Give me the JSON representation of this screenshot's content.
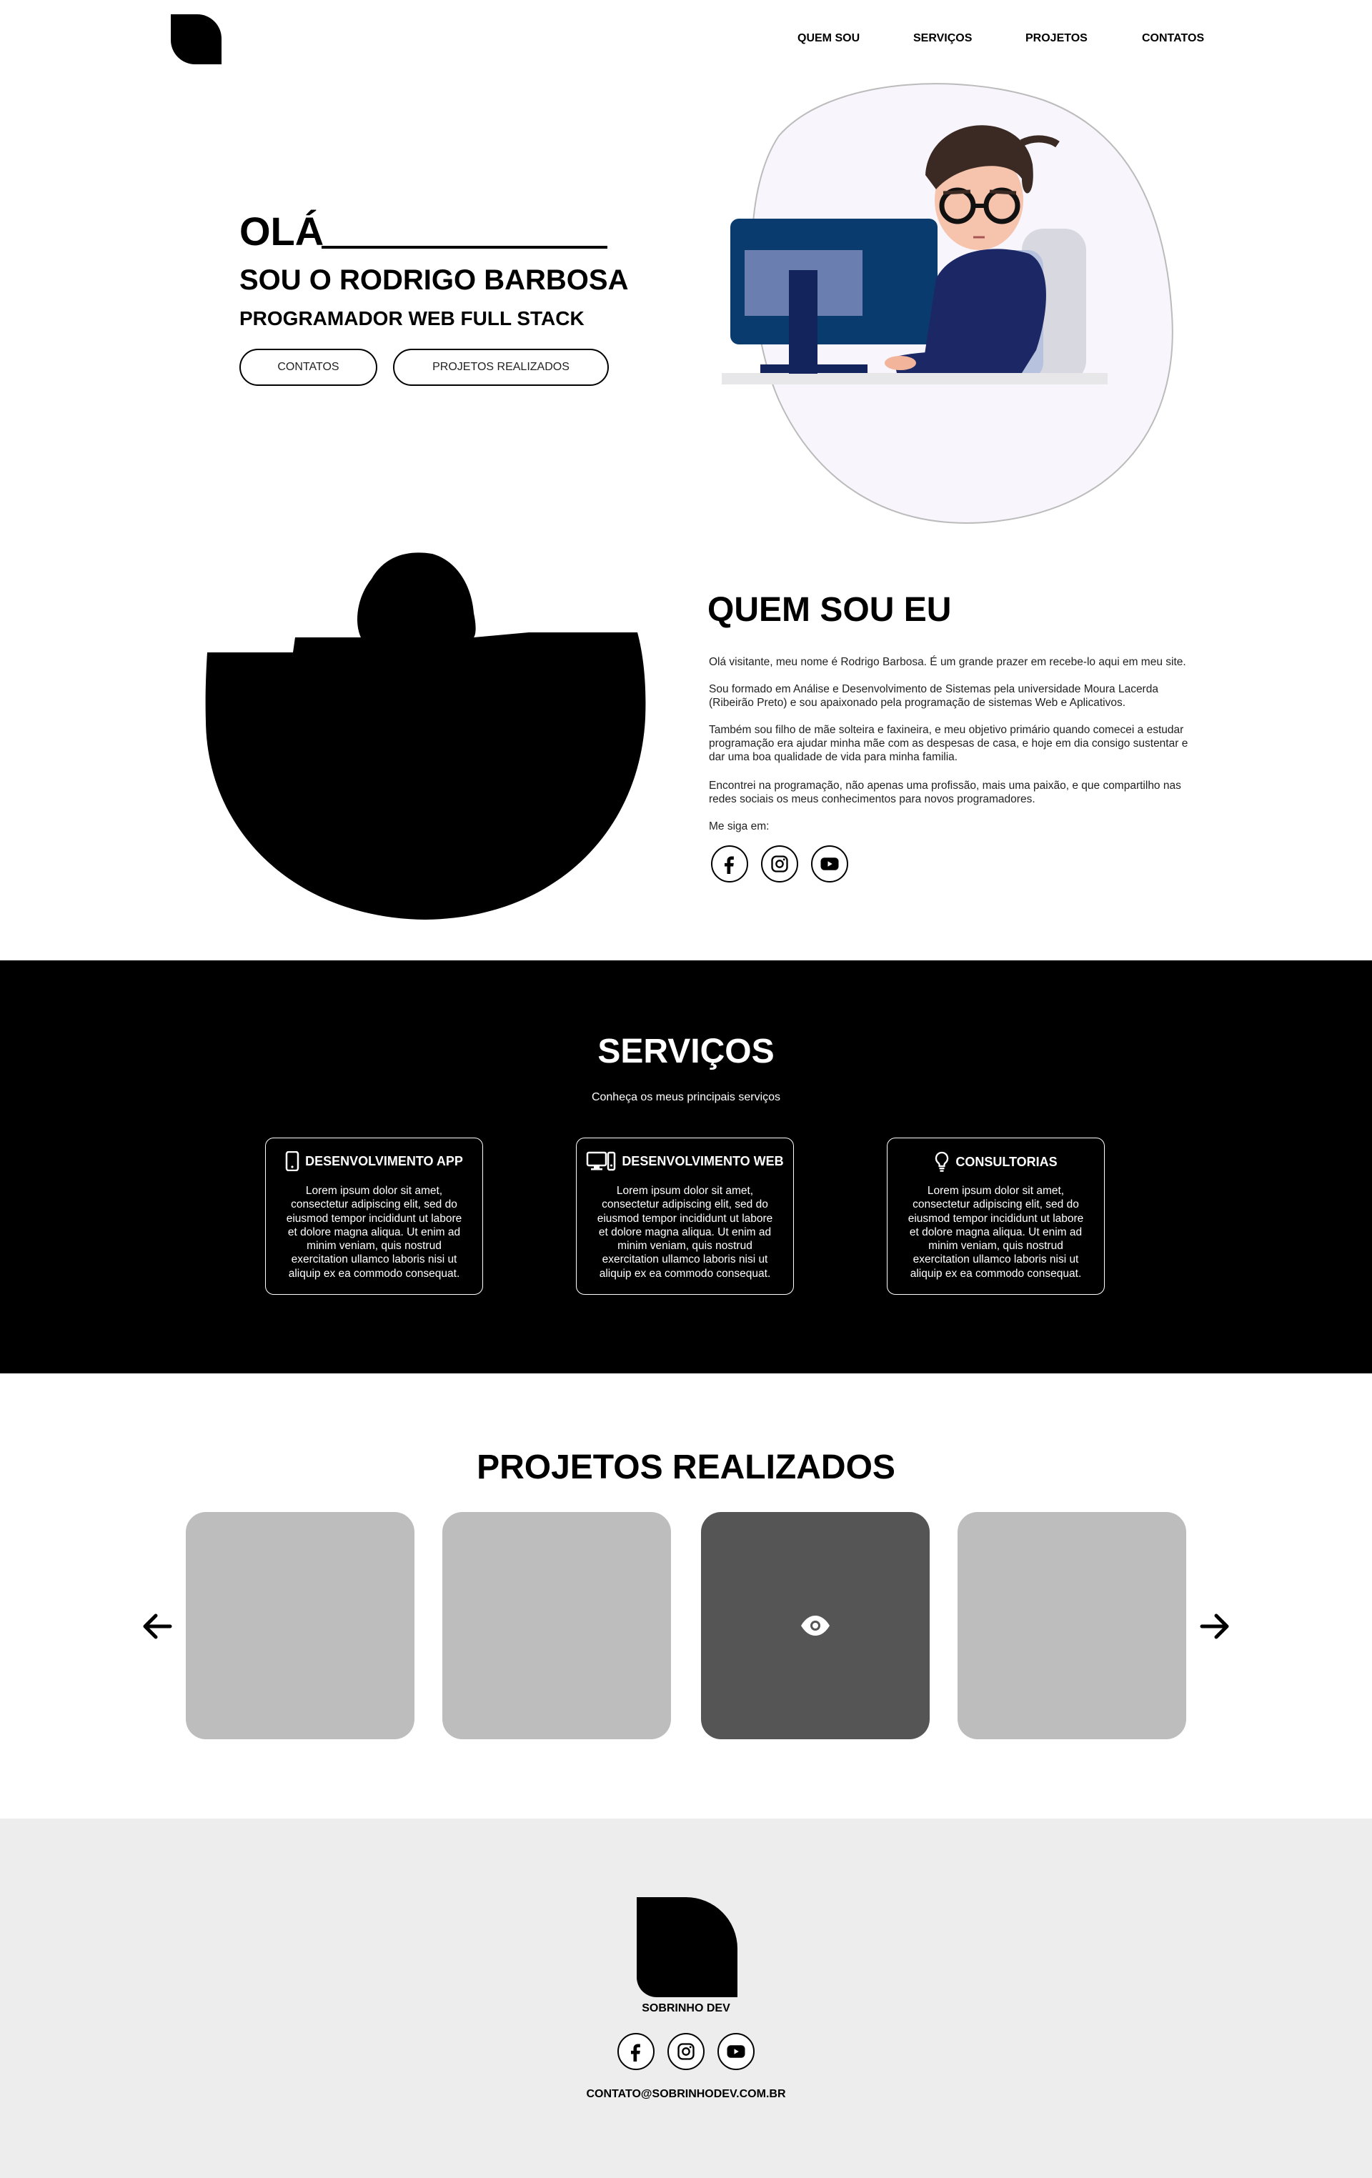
{
  "header": {
    "nav": [
      "QUEM SOU",
      "SERVIÇOS",
      "PROJETOS",
      "CONTATOS"
    ]
  },
  "hero": {
    "greeting": "OLÁ",
    "name": "SOU O RODRIGO BARBOSA",
    "role": "PROGRAMADOR WEB FULL STACK",
    "btn_contacts": "CONTATOS",
    "btn_projects": "PROJETOS REALIZADOS"
  },
  "about": {
    "title": "QUEM SOU EU",
    "p1": "Olá visitante, meu nome é Rodrigo Barbosa. É um grande prazer em recebe-lo aqui em meu site.",
    "p2": "Sou formado em Análise e Desenvolvimento de Sistemas pela universidade Moura Lacerda (Ribeirão Preto) e sou apaixonado pela programação de sistemas Web e Aplicativos.",
    "p3": "Também sou filho de mãe solteira e faxineira, e meu objetivo primário quando comecei a estudar programação era ajudar minha mãe com as despesas de casa, e hoje em dia consigo sustentar e dar uma boa qualidade de vida para minha familia.",
    "p4": "Encontrei na programação, não apenas uma profissão, mais uma paixão, e que compartilho nas redes sociais os meus conhecimentos para novos programadores.",
    "follow": "Me siga em:"
  },
  "services": {
    "title": "SERVIÇOS",
    "subtitle": "Conheça os meus principais serviços",
    "cards": [
      {
        "title": "DESENVOLVIMENTO APP",
        "icon": "smartphone-icon",
        "text": "Lorem ipsum dolor sit amet, consectetur adipiscing elit, sed do eiusmod tempor incididunt ut labore et dolore magna aliqua. Ut enim ad minim veniam, quis nostrud exercitation ullamco laboris nisi ut aliquip ex ea commodo consequat."
      },
      {
        "title": "DESENVOLVIMENTO WEB",
        "icon": "desktop-icon",
        "text": "Lorem ipsum dolor sit amet, consectetur adipiscing elit, sed do eiusmod tempor incididunt ut labore et dolore magna aliqua. Ut enim ad minim veniam, quis nostrud exercitation ullamco laboris nisi ut aliquip ex ea commodo consequat."
      },
      {
        "title": "CONSULTORIAS",
        "icon": "lightbulb-icon",
        "text": "Lorem ipsum dolor sit amet, consectetur adipiscing elit, sed do eiusmod tempor incididunt ut labore et dolore magna aliqua. Ut enim ad minim veniam, quis nostrud exercitation ullamco laboris nisi ut aliquip ex ea commodo consequat."
      }
    ]
  },
  "projects": {
    "title": "PROJETOS REALIZADOS"
  },
  "footer": {
    "brand": "SOBRINHO DEV",
    "email": "CONTATO@SOBRINHODEV.COM.BR"
  },
  "colors": {
    "black": "#000000",
    "card_gray": "#bdbdbd",
    "card_active": "#555555",
    "footer_bg": "#ededed",
    "blob_bg": "#f8f6fc"
  }
}
